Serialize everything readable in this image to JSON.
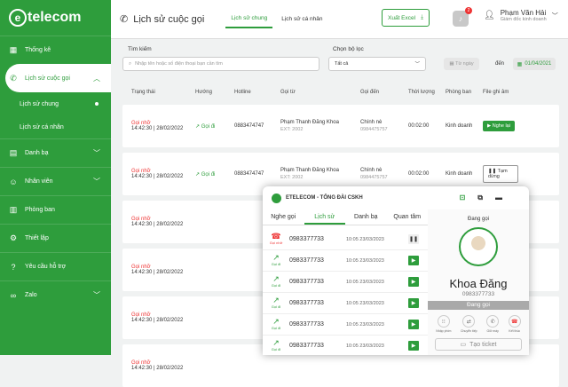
{
  "brand": {
    "logo_letter": "e",
    "logo_text": "telecom",
    "accent": "#2e9d3c",
    "missed_color": "#e33333"
  },
  "sidebar": {
    "items": [
      {
        "icon": "grid-icon",
        "glyph": "▦",
        "label": "Thống kê"
      },
      {
        "icon": "phone-icon",
        "glyph": "✆",
        "label": "Lịch sử cuộc gọi",
        "active": true
      },
      {
        "icon": "book-icon",
        "glyph": "▤",
        "label": "Danh bạ"
      },
      {
        "icon": "users-icon",
        "glyph": "☺",
        "label": "Nhân viên"
      },
      {
        "icon": "building-icon",
        "glyph": "▥",
        "label": "Phòng ban"
      },
      {
        "icon": "gear-icon",
        "glyph": "⚙",
        "label": "Thiết lập"
      },
      {
        "icon": "help-icon",
        "glyph": "?",
        "label": "Yêu cầu hỗ trợ"
      },
      {
        "icon": "link-icon",
        "glyph": "∞",
        "label": "Zalo"
      }
    ],
    "subitems": [
      {
        "label": "Lịch sử chung"
      },
      {
        "label": "Lịch sử cá nhân"
      }
    ]
  },
  "header": {
    "title": "Lịch sử cuộc gọi",
    "tabs": [
      {
        "label": "Lịch sử chung"
      },
      {
        "label": "Lịch sử cá nhân"
      }
    ],
    "export_label": "Xuất Excel",
    "notif_count": "2",
    "user_name": "Phạm Văn Hải",
    "user_role": "Giám đốc kinh doanh"
  },
  "filters": {
    "search_label": "Tìm kiếm",
    "search_placeholder": "Nhập tên hoặc số điện thoại bạn cần tìm",
    "select_label": "Chọn bộ lọc",
    "select_value": "Tất cả",
    "date_from": "Từ ngày",
    "date_sep": "đến",
    "date_to": "01/04/2021"
  },
  "table": {
    "headers": [
      "Trạng thái",
      "Hướng",
      "Hotline",
      "Gọi từ",
      "Gọi đến",
      "Thời lượng",
      "Phòng ban",
      "File ghi âm"
    ],
    "rows": [
      {
        "status": "Gọi nhỡ",
        "time": "14:42:30 | 28/02/2022",
        "direction": "Gọi đi",
        "hotline": "0883474747",
        "from": "Phạm Thanh Đăng Khoa",
        "from_ext": "EXT: 2002",
        "to": "Chính nè",
        "to_num": "0984475757",
        "duration": "00:02:00",
        "dept": "Kinh doanh",
        "rec": "Nghe lại",
        "rec_state": "play"
      },
      {
        "status": "Gọi nhỡ",
        "time": "14:42:30 | 28/02/2022",
        "direction": "Gọi đi",
        "hotline": "0883474747",
        "from": "Phạm Thanh Đăng Khoa",
        "from_ext": "EXT: 2002",
        "to": "Chính nè",
        "to_num": "0984475757",
        "duration": "00:02:00",
        "dept": "Kinh doanh",
        "rec": "Tạm dừng",
        "rec_state": "pause"
      },
      {
        "status": "Gọi nhỡ",
        "time": "14:42:30 | 28/02/2022"
      },
      {
        "status": "Gọi nhỡ",
        "time": "14:42:30 | 28/02/2022"
      },
      {
        "status": "Gọi nhỡ",
        "time": "14:42:30 | 28/02/2022"
      },
      {
        "status": "Gọi nhỡ",
        "time": "14:42:30 | 28/02/2022"
      }
    ]
  },
  "popup": {
    "title": "ETELECOM - TỔNG ĐÀI CSKH",
    "tabs": [
      {
        "label": "Nghe gọi"
      },
      {
        "label": "Lịch sử"
      },
      {
        "label": "Danh bạ"
      },
      {
        "label": "Quan tâm"
      }
    ],
    "calls": [
      {
        "type_label": "Gọi nhỡ",
        "number": "0983377733",
        "time": "10:05 23/03/2023",
        "action": "pause"
      },
      {
        "type_label": "Gọi đi",
        "number": "0983377733",
        "time": "10:05 23/03/2023",
        "action": "play"
      },
      {
        "type_label": "Gọi đi",
        "number": "0983377733",
        "time": "10:05 23/03/2023",
        "action": "play"
      },
      {
        "type_label": "Gọi đi",
        "number": "0983377733",
        "time": "10:05 23/03/2023",
        "action": "play"
      },
      {
        "type_label": "Gọi đi",
        "number": "0983377733",
        "time": "10:05 23/03/2023",
        "action": "play"
      },
      {
        "type_label": "Gọi đi",
        "number": "0983377733",
        "time": "10:05 23/03/2023",
        "action": "play"
      }
    ],
    "current": {
      "state": "Đang gọi",
      "name": "Khoa Đăng",
      "number": "0983377733",
      "status_bar": "Đang gọi",
      "controls": [
        "Nhập phím",
        "Chuyển tiếp",
        "Giữ máy",
        "Kết thúc"
      ],
      "ticket": "Tạo ticket"
    }
  }
}
